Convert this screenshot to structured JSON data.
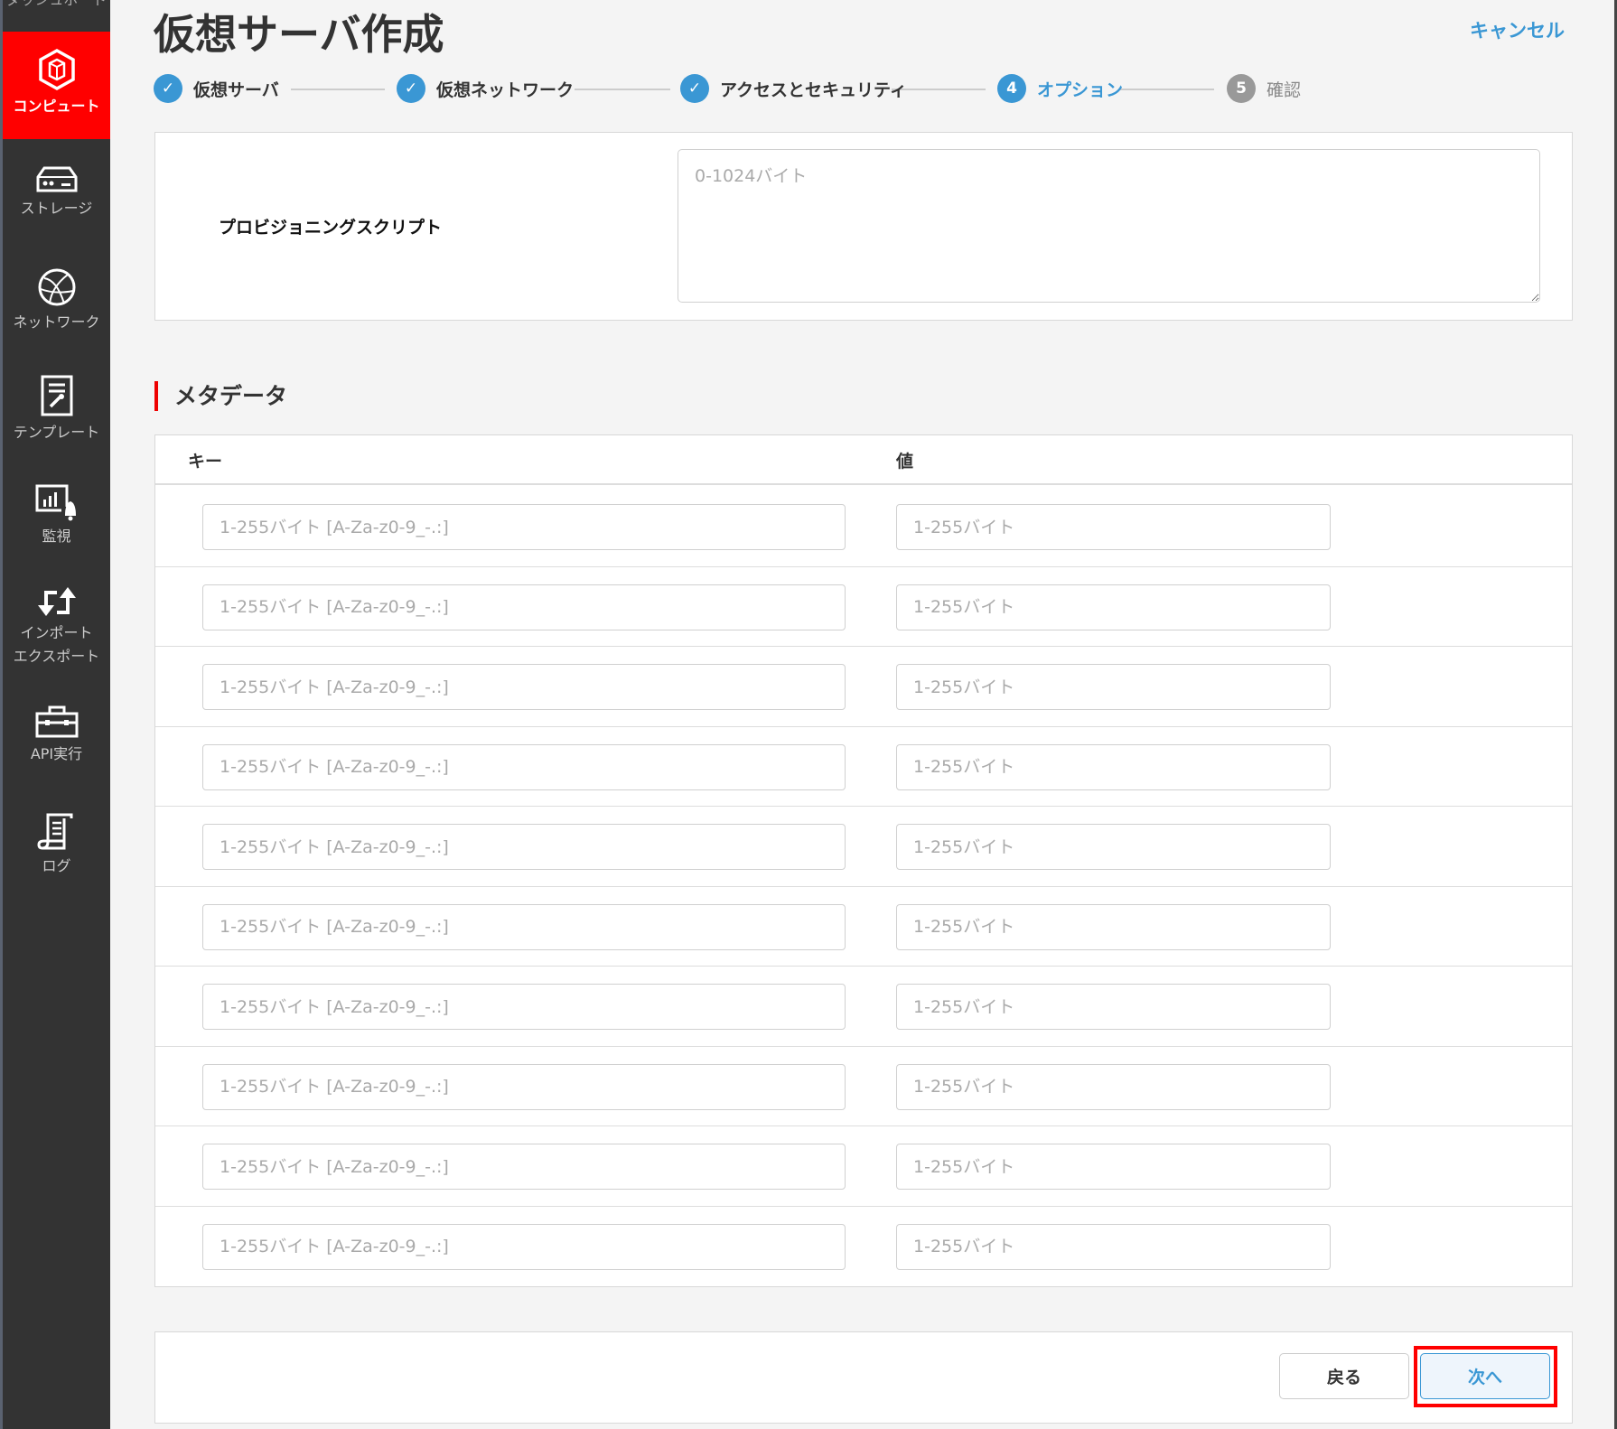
{
  "sidebar": {
    "cut_item": "ダッシュボード",
    "items": [
      {
        "label": "コンピュート",
        "icon": "compute-icon"
      },
      {
        "label": "ストレージ",
        "icon": "storage-icon"
      },
      {
        "label": "ネットワーク",
        "icon": "network-icon"
      },
      {
        "label": "テンプレート",
        "icon": "template-icon"
      },
      {
        "label": "監視",
        "icon": "monitor-icon"
      },
      {
        "label": "インポート",
        "label2": "エクスポート",
        "icon": "import-export-icon"
      },
      {
        "label": "API実行",
        "icon": "toolbox-icon"
      },
      {
        "label": "ログ",
        "icon": "log-icon"
      }
    ]
  },
  "header": {
    "title": "仮想サーバ作成",
    "cancel": "キャンセル"
  },
  "steps": [
    {
      "num": "✓",
      "label": "仮想サーバ",
      "state": "done"
    },
    {
      "num": "✓",
      "label": "仮想ネットワーク",
      "state": "done"
    },
    {
      "num": "✓",
      "label": "アクセスとセキュリティ",
      "state": "done"
    },
    {
      "num": "4",
      "label": "オプション",
      "state": "current"
    },
    {
      "num": "5",
      "label": "確認",
      "state": "pending"
    }
  ],
  "provisioning": {
    "label": "プロビジョニングスクリプト",
    "placeholder": "0-1024バイト",
    "value": ""
  },
  "metadata": {
    "heading": "メタデータ",
    "col_key": "キー",
    "col_value": "値",
    "key_placeholder": "1-255バイト [A-Za-z0-9_-.:]",
    "value_placeholder": "1-255バイト",
    "row_count": 10
  },
  "footer": {
    "back": "戻る",
    "next": "次へ"
  },
  "colors": {
    "accent": "#3a97d4",
    "brand": "#ff0000",
    "sidebar": "#333333"
  }
}
